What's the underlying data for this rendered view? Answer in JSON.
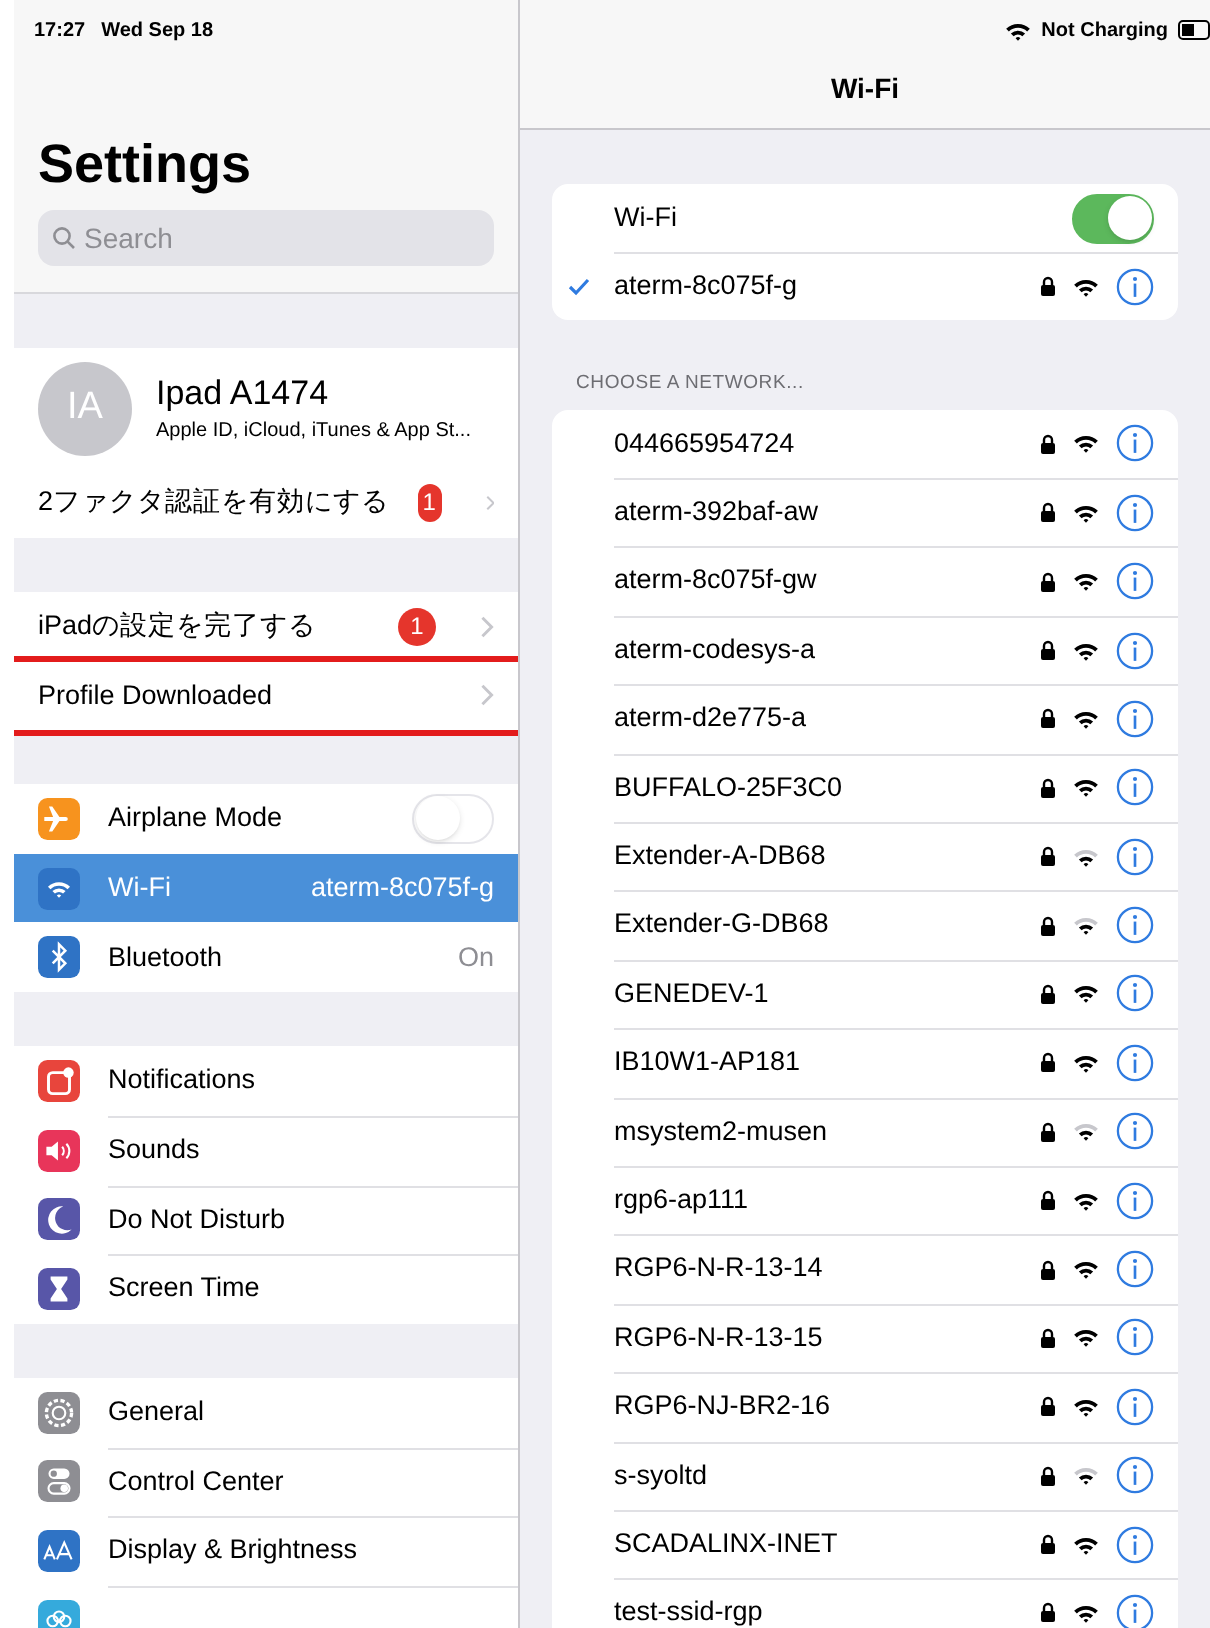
{
  "status_bar": {
    "time": "17:27",
    "date": "Wed Sep 18",
    "charging": "Not Charging"
  },
  "sidebar": {
    "title": "Settings",
    "search": {
      "placeholder": "Search"
    },
    "account": {
      "initials": "IA",
      "name": "Ipad A1474",
      "subtitle": "Apple ID, iCloud, iTunes & App St..."
    },
    "groups": [
      [
        {
          "kind": "plain",
          "label": "2ファクタ認証を有効にする",
          "badge": "1",
          "highlighted": false,
          "selected": false
        }
      ],
      [
        {
          "kind": "plain",
          "label": "iPadの設定を完了する",
          "badge": "1",
          "highlighted": false,
          "selected": false
        },
        {
          "kind": "plain",
          "label": "Profile Downloaded",
          "highlighted": true,
          "selected": false
        }
      ],
      [
        {
          "kind": "toggle",
          "label": "Airplane Mode",
          "on": false,
          "selected": false
        },
        {
          "kind": "value",
          "label": "Wi-Fi",
          "value": "aterm-8c075f-g",
          "selected": true
        },
        {
          "kind": "value",
          "label": "Bluetooth",
          "value": "On",
          "selected": false
        }
      ],
      [
        {
          "kind": "link",
          "label": "Notifications",
          "selected": false
        },
        {
          "kind": "link",
          "label": "Sounds",
          "selected": false
        },
        {
          "kind": "link",
          "label": "Do Not Disturb",
          "selected": false
        },
        {
          "kind": "link",
          "label": "Screen Time",
          "selected": false
        }
      ],
      [
        {
          "kind": "link",
          "label": "General",
          "selected": false
        },
        {
          "kind": "link",
          "label": "Control Center",
          "selected": false
        },
        {
          "kind": "link",
          "label": "Display & Brightness",
          "selected": false
        },
        {
          "kind": "link",
          "selected": false
        }
      ]
    ]
  },
  "detail": {
    "title": "Wi-Fi",
    "wifi_toggle": {
      "label": "Wi-Fi",
      "on": true
    },
    "connected": {
      "name": "aterm-8c075f-g",
      "weak_signal": false
    },
    "section_header": "CHOOSE A NETWORK...",
    "networks": [
      {
        "name": "044665954724",
        "weak_signal": false
      },
      {
        "name": "aterm-392baf-aw",
        "weak_signal": false
      },
      {
        "name": "aterm-8c075f-gw",
        "weak_signal": false
      },
      {
        "name": "aterm-codesys-a",
        "weak_signal": false
      },
      {
        "name": "aterm-d2e775-a",
        "weak_signal": false
      },
      {
        "name": "BUFFALO-25F3C0",
        "weak_signal": false
      },
      {
        "name": "Extender-A-DB68",
        "weak_signal": true
      },
      {
        "name": "Extender-G-DB68",
        "weak_signal": true
      },
      {
        "name": "GENEDEV-1",
        "weak_signal": false
      },
      {
        "name": "IB10W1-AP181",
        "weak_signal": false
      },
      {
        "name": "msystem2-musen",
        "weak_signal": true
      },
      {
        "name": "rgp6-ap111",
        "weak_signal": false
      },
      {
        "name": "RGP6-N-R-13-14",
        "weak_signal": false
      },
      {
        "name": "RGP6-N-R-13-15",
        "weak_signal": false
      },
      {
        "name": "RGP6-NJ-BR2-16",
        "weak_signal": false
      },
      {
        "name": "s-syoltd",
        "weak_signal": true
      },
      {
        "name": "SCADALINX-INET",
        "weak_signal": false
      },
      {
        "name": "test-ssid-rgp",
        "weak_signal": false
      }
    ]
  }
}
